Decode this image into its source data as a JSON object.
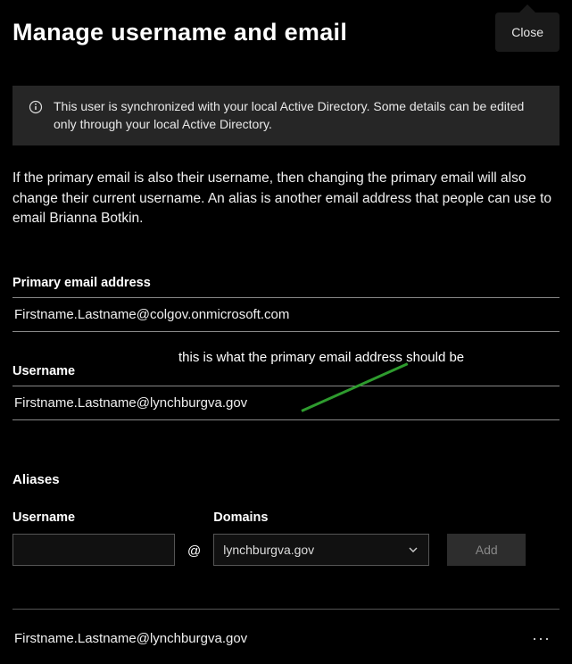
{
  "header": {
    "title": "Manage username and email",
    "close_label": "Close"
  },
  "info_banner": {
    "text": "This user is synchronized with your local Active Directory. Some details can be edited only through your local Active Directory."
  },
  "description": "If the primary email is also their username, then changing the primary email will also change their current username. An alias is another email address that people can use to email Brianna Botkin.",
  "primary_email": {
    "label": "Primary email address",
    "value": "Firstname.Lastname@colgov.onmicrosoft.com"
  },
  "annotation": {
    "text": "this is what the primary email address should be"
  },
  "username": {
    "label": "Username",
    "value": "Firstname.Lastname@lynchburgva.gov"
  },
  "aliases": {
    "heading": "Aliases",
    "username_label": "Username",
    "username_value": "",
    "domains_label": "Domains",
    "domain_selected": "lynchburgva.gov",
    "add_label": "Add",
    "entries": [
      {
        "email": "Firstname.Lastname@lynchburgva.gov"
      }
    ]
  }
}
